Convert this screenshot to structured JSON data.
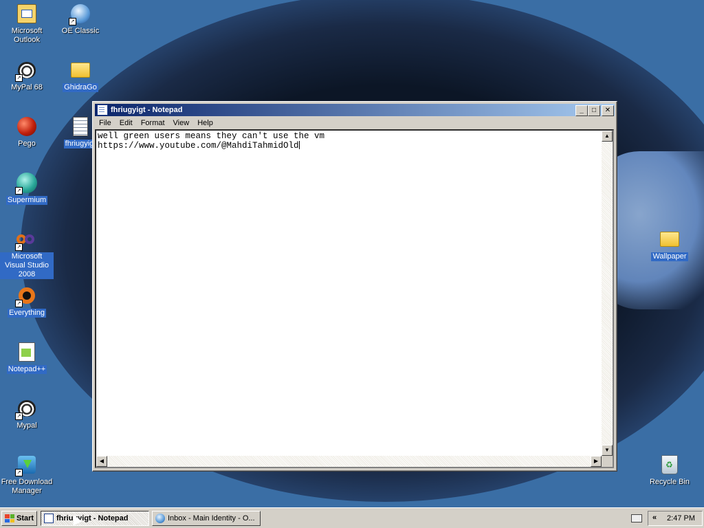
{
  "desktop": {
    "icons": [
      {
        "label": "Microsoft Outlook",
        "icon": "outlook-icon"
      },
      {
        "label": "OE Classic",
        "icon": "oe-classic-icon"
      },
      {
        "label": "MyPal 68",
        "icon": "mypal-icon"
      },
      {
        "label": "GhidraGo",
        "icon": "folder-icon"
      },
      {
        "label": "Pego",
        "icon": "pego-icon"
      },
      {
        "label": "fhriugyigt",
        "icon": "text-file-icon"
      },
      {
        "label": "Supermium",
        "icon": "supermium-icon"
      },
      {
        "label": "Microsoft Visual Studio 2008",
        "icon": "visual-studio-icon"
      },
      {
        "label": "Everything",
        "icon": "everything-icon"
      },
      {
        "label": "Notepad++",
        "icon": "notepadpp-icon"
      },
      {
        "label": "Mypal",
        "icon": "mypal-icon"
      },
      {
        "label": "Free Download Manager",
        "icon": "fdm-icon"
      },
      {
        "label": "Wallpaper",
        "icon": "folder-icon"
      },
      {
        "label": "Recycle Bin",
        "icon": "recycle-bin-icon"
      }
    ],
    "colors": {
      "background": "#3a6ea5",
      "selection": "#316ac5"
    }
  },
  "window": {
    "title": "fhriugyigt - Notepad",
    "menu": [
      "File",
      "Edit",
      "Format",
      "View",
      "Help"
    ],
    "content": {
      "line1": "well green users means they can't use the vm",
      "line2": "https://www.youtube.com/@MahdiTahmidOld"
    },
    "title_gradient": [
      "#0a246a",
      "#a6caf0"
    ]
  },
  "taskbar": {
    "start_label": "Start",
    "tasks": [
      {
        "label": "fhriugyigt - Notepad",
        "active": true
      },
      {
        "label": "Inbox - Main Identity - O...",
        "active": false
      }
    ],
    "tray_chevron": "«",
    "clock": "2:47 PM"
  }
}
